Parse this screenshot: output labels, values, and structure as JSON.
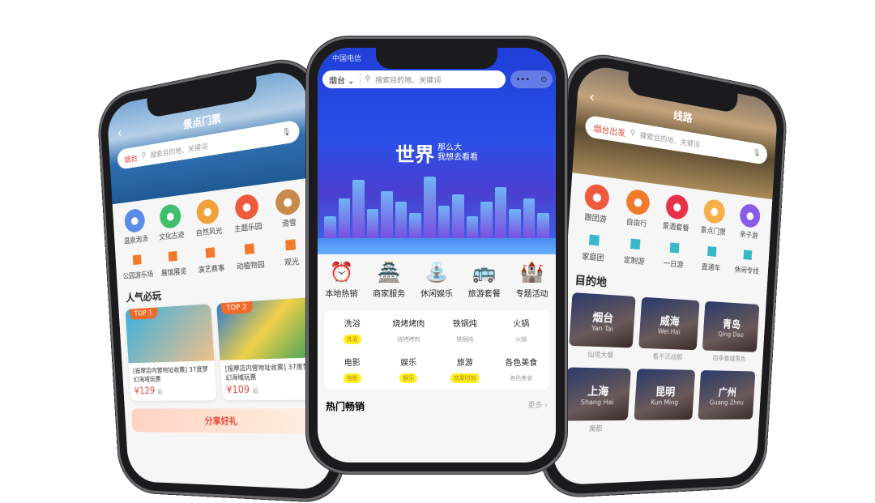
{
  "left_phone": {
    "title": "景点门票",
    "back": "‹",
    "search": {
      "city": "烟台",
      "placeholder": "搜索目的地、关键词"
    },
    "icons_row1": [
      {
        "label": "温泉泡汤",
        "color": "#5b8de8"
      },
      {
        "label": "文化古迹",
        "color": "#3fbf6a"
      },
      {
        "label": "自然风光",
        "color": "#f0a23a"
      },
      {
        "label": "主题乐园",
        "color": "#ef5a3c"
      },
      {
        "label": "滑雪",
        "color": "#c88a4a"
      }
    ],
    "icons_row2": [
      {
        "label": "公园游乐场",
        "color": "#f07a2a"
      },
      {
        "label": "展馆展览",
        "color": "#f07a2a"
      },
      {
        "label": "演艺赛事",
        "color": "#f07a2a"
      },
      {
        "label": "动植物园",
        "color": "#f07a2a"
      },
      {
        "label": "观光",
        "color": "#f07a2a"
      }
    ],
    "section": "人气必玩",
    "cards": [
      {
        "tag": "TOP 1",
        "text": "[按摩店内营地址收票] 37度梦幻海域玩票",
        "price": "¥129",
        "suffix": "起"
      },
      {
        "tag": "TOP 2",
        "text": "[按摩店内营地址收票] 37度梦幻海域玩票",
        "price": "¥109",
        "suffix": "起"
      }
    ],
    "promo": "分享好礼"
  },
  "center_phone": {
    "status": "中国电信",
    "search": {
      "city": "烟台 ⌄",
      "placeholder": "搜索目的地、关键词"
    },
    "capsule": {
      "more": "•••",
      "target": "⊙"
    },
    "slogan": {
      "big": "世界",
      "line1": "那么大",
      "line2": "我想去看看"
    },
    "categories": [
      {
        "label": "本地热销",
        "icon": "⏰"
      },
      {
        "label": "商家服务",
        "icon": "🏯"
      },
      {
        "label": "休闲娱乐",
        "icon": "⛲"
      },
      {
        "label": "旅游套餐",
        "icon": "🚌"
      },
      {
        "label": "专题活动",
        "icon": "🏰"
      }
    ],
    "grid": [
      {
        "title": "洗浴",
        "sub": "洗浴",
        "hl": true
      },
      {
        "title": "烧烤烤肉",
        "sub": "烧烤烤肉",
        "hl": false
      },
      {
        "title": "铁锅炖",
        "sub": "铁锅炖",
        "hl": false
      },
      {
        "title": "火锅",
        "sub": "火锅",
        "hl": false
      },
      {
        "title": "电影",
        "sub": "电影",
        "hl": true
      },
      {
        "title": "娱乐",
        "sub": "娱乐",
        "hl": true
      },
      {
        "title": "旅游",
        "sub": "欢聚时刻",
        "hl": true
      },
      {
        "title": "各色美食",
        "sub": "各色美食",
        "hl": false
      }
    ],
    "hot": {
      "title": "热门畅销",
      "more": "更多 ›"
    },
    "accent": "#2a4fe6"
  },
  "right_phone": {
    "title": "线路",
    "back": "‹",
    "search": {
      "city": "烟台出发",
      "placeholder": "搜索目的地、关键词"
    },
    "icons_row1": [
      {
        "label": "跟团游",
        "color": "#ef5a3c"
      },
      {
        "label": "自由行",
        "color": "#f07a2a"
      },
      {
        "label": "景酒套餐",
        "color": "#e8304a"
      },
      {
        "label": "景点门票",
        "color": "#f5b04a"
      },
      {
        "label": "亲子游",
        "color": "#8a5ae8"
      }
    ],
    "icons_row2": [
      {
        "label": "家庭团",
        "color": "#3ab8c8"
      },
      {
        "label": "定制游",
        "color": "#3ab8c8"
      },
      {
        "label": "一日游",
        "color": "#3ab8c8"
      },
      {
        "label": "直通车",
        "color": "#3ab8c8"
      },
      {
        "label": "休闲专线",
        "color": "#3ab8c8"
      }
    ],
    "section": "目的地",
    "destinations": [
      {
        "name": "烟台",
        "pinyin": "Yan Tai",
        "sub": "仙境大餐"
      },
      {
        "name": "威海",
        "pinyin": "Wei Hai",
        "sub": "看不沉战舰"
      },
      {
        "name": "青岛",
        "pinyin": "Qing Dao",
        "sub": "四季春城青色"
      },
      {
        "name": "上海",
        "pinyin": "Shang Hai",
        "sub": "魔都"
      },
      {
        "name": "昆明",
        "pinyin": "Kun Ming",
        "sub": ""
      },
      {
        "name": "广州",
        "pinyin": "Guang Zhou",
        "sub": ""
      }
    ]
  }
}
